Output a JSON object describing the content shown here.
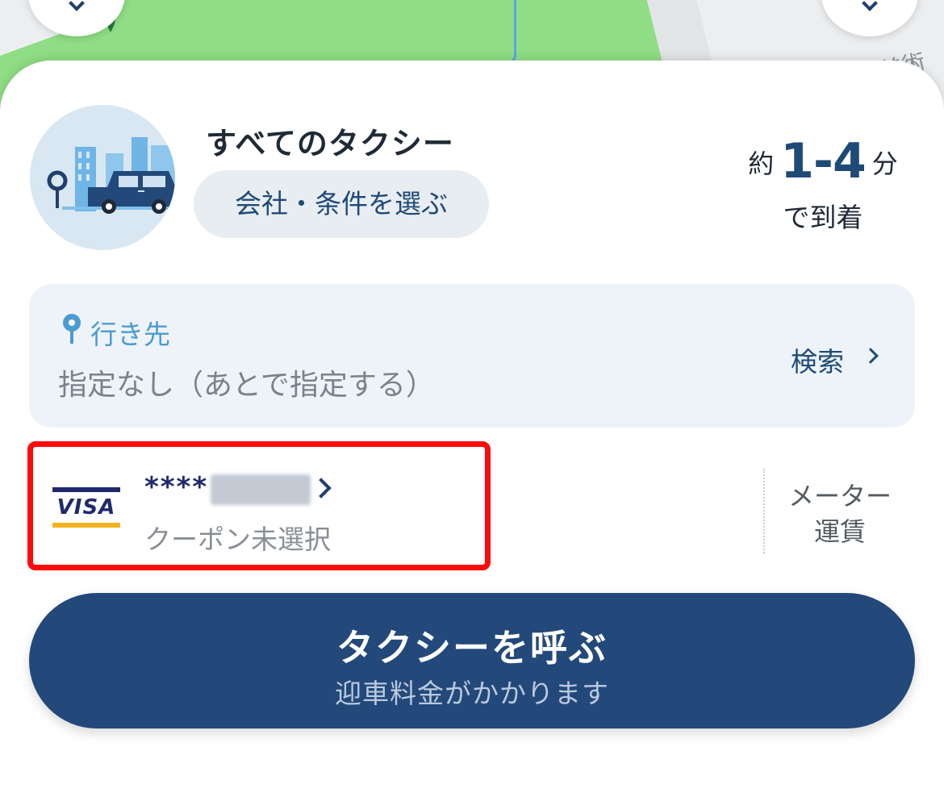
{
  "map": {
    "label": "美術館",
    "colors": {
      "park": "#8fdd84",
      "river": "#5aa6e8"
    }
  },
  "taxi": {
    "title": "すべてのタクシー",
    "select_button": "会社・条件を選ぶ",
    "eta_prefix": "約",
    "eta_range": "1-4",
    "eta_unit": "分",
    "eta_suffix": "で到着"
  },
  "destination": {
    "label": "行き先",
    "value": "指定なし（あとで指定する）",
    "search_label": "検索"
  },
  "payment": {
    "card_brand": "VISA",
    "card_masked": "****",
    "coupon": "クーポン未選択",
    "fare_line1": "メーター",
    "fare_line2": "運賃"
  },
  "call": {
    "label": "タクシーを呼ぶ",
    "sub": "迎車料金がかかります"
  },
  "colors": {
    "primary": "#23497a",
    "highlight": "#ff0a0a",
    "accent_blue": "#4b9bd2"
  }
}
